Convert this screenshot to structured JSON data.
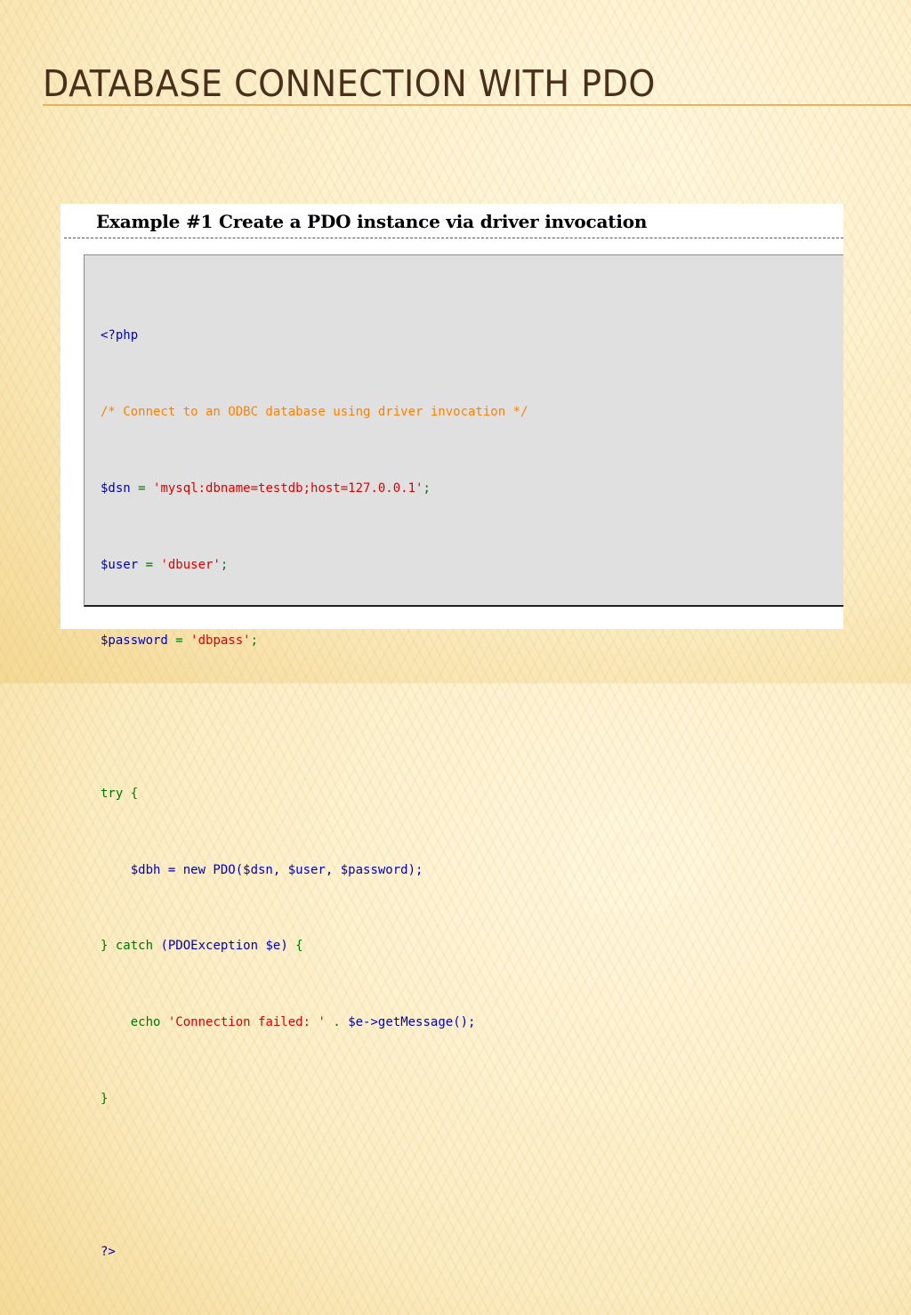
{
  "slide": {
    "title": "Database connection with PDO"
  },
  "example": {
    "heading": "Example #1 Create a PDO instance via driver invocation",
    "code": {
      "php_open": "<?php",
      "comment": "/* Connect to an ODBC database using driver invocation */",
      "dsn_var": "$dsn",
      "dsn_value": "'mysql:dbname=testdb;host=127.0.0.1'",
      "user_var": "$user",
      "user_value": "'dbuser'",
      "password_var": "$password",
      "password_value": "'dbpass'",
      "try_kw": "try",
      "dbh_assign": "$dbh = new PDO($dsn, $user, $password);",
      "catch_kw": "catch",
      "catch_args": "(PDOException $e)",
      "echo_kw": "echo",
      "echo_string": "'Connection failed: '",
      "echo_rest": "$e->getMessage();",
      "php_close": "?>"
    }
  },
  "colors": {
    "title": "#4a2f1b",
    "title_rule": "#e8b35c",
    "php_keyword": "#007700",
    "php_variable": "#0000bb",
    "php_string": "#dd0000",
    "php_comment": "#ff8000"
  }
}
